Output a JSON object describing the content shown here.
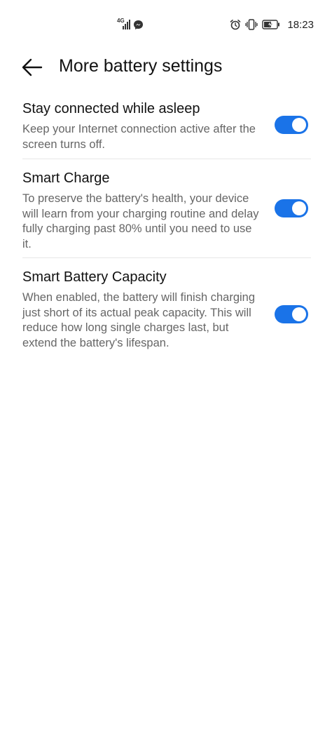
{
  "status_bar": {
    "network": "4G",
    "time": "18:23",
    "icons": [
      "signal-icon",
      "messenger-icon",
      "alarm-icon",
      "vibrate-icon",
      "battery-charging-icon"
    ]
  },
  "header": {
    "back_icon": "arrow-left-icon",
    "title": "More battery settings"
  },
  "settings": [
    {
      "title": "Stay connected while asleep",
      "description": "Keep your Internet connection active after the screen turns off.",
      "enabled": true
    },
    {
      "title": "Smart Charge",
      "description": "To preserve the battery's health, your device will learn from your charging routine and delay fully charging past 80% until you need to use it.",
      "enabled": true
    },
    {
      "title": "Smart Battery Capacity",
      "description": "When enabled, the battery will finish charging just short of its actual peak capacity. This will reduce how long single charges last, but extend the battery's lifespan.",
      "enabled": true
    }
  ],
  "colors": {
    "toggle_on": "#1a73e8",
    "title_text": "#111111",
    "description_text": "#666666"
  }
}
